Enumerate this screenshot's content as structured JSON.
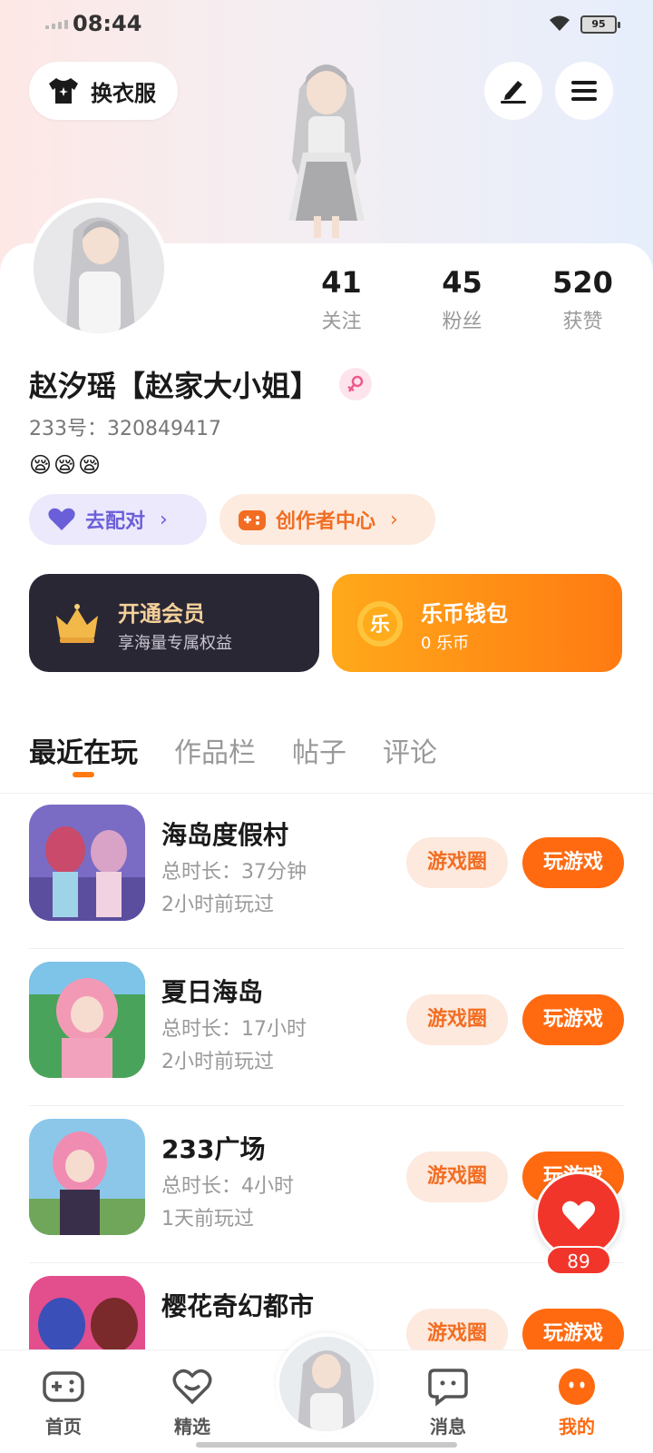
{
  "status_bar": {
    "time": "08:44",
    "battery": "95"
  },
  "header": {
    "outfit_label": "换衣服"
  },
  "profile": {
    "name": "赵汐瑶【赵家大小姐】",
    "uid": "233号：320849417",
    "emoji": "😪😪😪",
    "stats": [
      {
        "value": "41",
        "label": "关注"
      },
      {
        "value": "45",
        "label": "粉丝"
      },
      {
        "value": "520",
        "label": "获赞"
      }
    ],
    "tags": {
      "pair": "去配对",
      "creator": "创作者中心"
    }
  },
  "banners": {
    "vip": {
      "title": "开通会员",
      "subtitle": "享海量专属权益"
    },
    "wallet": {
      "title": "乐币钱包",
      "subtitle": "0 乐币",
      "coin_char": "乐"
    }
  },
  "tabs": [
    "最近在玩",
    "作品栏",
    "帖子",
    "评论"
  ],
  "games": [
    {
      "name": "海岛度假村",
      "duration": "总时长：37分钟",
      "last_played": "2小时前玩过",
      "circle_label": "游戏圈",
      "play_label": "玩游戏"
    },
    {
      "name": "夏日海岛",
      "duration": "总时长：17小时",
      "last_played": "2小时前玩过",
      "circle_label": "游戏圈",
      "play_label": "玩游戏"
    },
    {
      "name": "233广场",
      "duration": "总时长：4小时",
      "last_played": "1天前玩过",
      "circle_label": "游戏圈",
      "play_label": "玩游戏"
    },
    {
      "name": "樱花奇幻都市",
      "duration": "",
      "last_played": "",
      "circle_label": "游戏圈",
      "play_label": "玩游戏"
    }
  ],
  "like_fab": {
    "count": "89"
  },
  "bottom_nav": [
    {
      "label": "首页"
    },
    {
      "label": "精选"
    },
    {
      "label": "消息"
    },
    {
      "label": "我的"
    }
  ],
  "colors": {
    "accent": "#ff6a10",
    "vip_bg": "#2a2735",
    "like_red": "#f2352b"
  }
}
